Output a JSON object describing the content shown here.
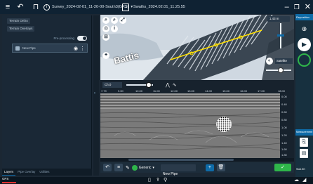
{
  "topbar": {
    "survey_title": "Survey_2024-02-01_11-20-00-South3(GPS)",
    "survey_dropdown": "▾",
    "file_title": "Swaths_2024.02.01_11.25.55"
  },
  "left_panel": {
    "chip_1": "Terrain Ortho",
    "chip_2": "Terrain Overlays",
    "toggle_label": "Pre-processing",
    "layer_name": "New Pipe",
    "tabs": [
      "Layers",
      "Pipe Overlay",
      "Utilities"
    ]
  },
  "map": {
    "label": "Battis",
    "zoom_readout": "1.43 m",
    "basemap_select": "Satellite"
  },
  "right_panel": {
    "header": "Reposition",
    "vertical_header": "Measurement",
    "footer_label": "Stat.KK"
  },
  "gram": {
    "channel_select": "Ch.0",
    "axis_ticks": [
      "7.79",
      "9.00",
      "10.00",
      "11.00",
      "12.00",
      "13.00",
      "14.00",
      "15.00",
      "16.00",
      "17.00",
      "18.00"
    ],
    "depth_ticks": [
      "0.00",
      "0.40",
      "0.60",
      "0.80",
      "1.00",
      "1.20",
      "1.40",
      "1.60",
      "1.80"
    ]
  },
  "bottom_toolbar": {
    "type_select": "Generic",
    "name_input": "New Pipe"
  },
  "status": {
    "label": "GPS"
  },
  "colors": {
    "topbar": "#0f2233",
    "accent_blue": "#0e6ba8",
    "accent_green": "#2fb54a"
  }
}
